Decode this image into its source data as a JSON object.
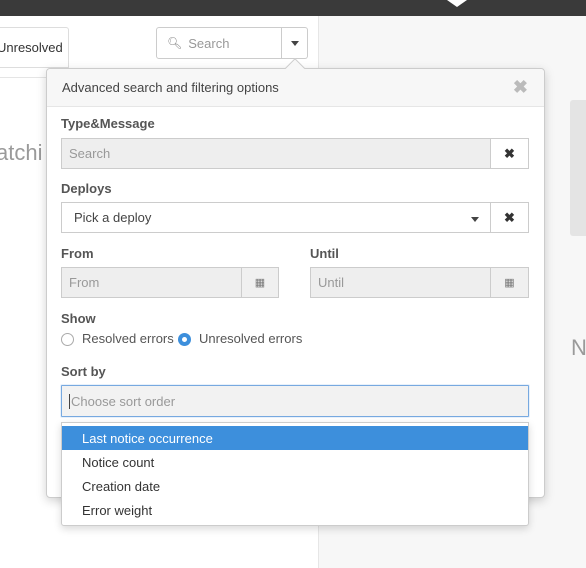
{
  "header_tabs": {
    "unresolved_label": "Unresolved"
  },
  "search": {
    "placeholder": "Search"
  },
  "background": {
    "left_text": "atchi",
    "right_text": "N"
  },
  "popover": {
    "title": "Advanced search and filtering options",
    "type_message": {
      "label": "Type&Message",
      "placeholder": "Search"
    },
    "deploys": {
      "label": "Deploys",
      "value": "Pick a deploy"
    },
    "from": {
      "label": "From",
      "placeholder": "From"
    },
    "until": {
      "label": "Until",
      "placeholder": "Until"
    },
    "show": {
      "label": "Show",
      "options": [
        {
          "label": "Resolved errors",
          "checked": false
        },
        {
          "label": "Unresolved errors",
          "checked": true
        }
      ]
    },
    "sort_by": {
      "label": "Sort by",
      "placeholder": "Choose sort order",
      "options": [
        "Last notice occurrence",
        "Notice count",
        "Creation date",
        "Error weight"
      ],
      "highlighted_index": 0
    }
  },
  "icons": {
    "close": "close-icon",
    "clear": "clear-icon",
    "calendar": "calendar-icon",
    "search": "search-icon",
    "caret": "chevron-down-icon"
  },
  "colors": {
    "accent": "#3d8fdc",
    "topbar": "#3a3a3a"
  }
}
